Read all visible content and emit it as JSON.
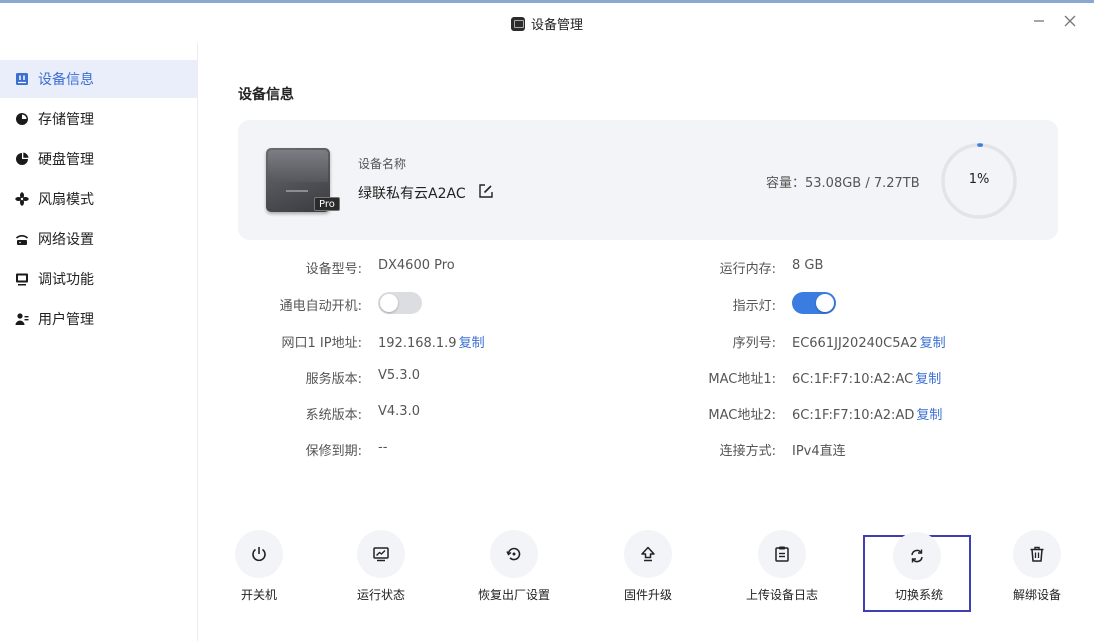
{
  "window": {
    "title": "设备管理",
    "icons": {
      "app": "device-icon",
      "minimize": "minimize-icon",
      "close": "close-icon"
    }
  },
  "sidebar": {
    "items": [
      {
        "label": "设备信息",
        "icon": "device-info-icon",
        "active": true
      },
      {
        "label": "存储管理",
        "icon": "pie-chart-icon"
      },
      {
        "label": "硬盘管理",
        "icon": "disk-pie-icon"
      },
      {
        "label": "风扇模式",
        "icon": "fan-icon"
      },
      {
        "label": "网络设置",
        "icon": "network-icon"
      },
      {
        "label": "调试功能",
        "icon": "debug-icon"
      },
      {
        "label": "用户管理",
        "icon": "users-icon"
      }
    ]
  },
  "main": {
    "title": "设备信息",
    "device": {
      "badge": "Pro",
      "name_label": "设备名称",
      "name": "绿联私有云A2AC",
      "capacity": "容量：53.08GB / 7.27TB",
      "usage_percent": "1%",
      "usage_fraction": 0.01
    },
    "left_rows": [
      {
        "label": "设备型号:",
        "value": "DX4600 Pro"
      },
      {
        "label": "通电自动开机:",
        "toggle": false
      },
      {
        "label": "网口1 IP地址:",
        "value": "192.168.1.9",
        "copy": "复制"
      },
      {
        "label": "服务版本:",
        "value": "V5.3.0"
      },
      {
        "label": "系统版本:",
        "value": "V4.3.0"
      },
      {
        "label": "保修到期:",
        "value": "--"
      }
    ],
    "right_rows": [
      {
        "label": "运行内存:",
        "value": "8 GB"
      },
      {
        "label": "指示灯:",
        "toggle": true
      },
      {
        "label": "序列号:",
        "value": "EC661JJ20240C5A2",
        "copy": "复制"
      },
      {
        "label": "MAC地址1:",
        "value": "6C:1F:F7:10:A2:AC",
        "copy": "复制"
      },
      {
        "label": "MAC地址2:",
        "value": "6C:1F:F7:10:A2:AD",
        "copy": "复制"
      },
      {
        "label": "连接方式:",
        "value": "IPv4直连"
      }
    ],
    "actions": [
      {
        "label": "开关机",
        "icon": "power-icon"
      },
      {
        "label": "运行状态",
        "icon": "monitor-chart-icon"
      },
      {
        "label": "恢复出厂设置",
        "icon": "restore-icon"
      },
      {
        "label": "固件升级",
        "icon": "upgrade-icon"
      },
      {
        "label": "上传设备日志",
        "icon": "log-icon"
      },
      {
        "label": "切换系统",
        "icon": "switch-icon",
        "selected": true
      },
      {
        "label": "解绑设备",
        "icon": "trash-icon"
      }
    ]
  },
  "colors": {
    "accent": "#3b6fd4",
    "toggle_on": "#3b7ce0",
    "card_bg": "#f3f4f7",
    "active_bg": "#e9eefa"
  }
}
